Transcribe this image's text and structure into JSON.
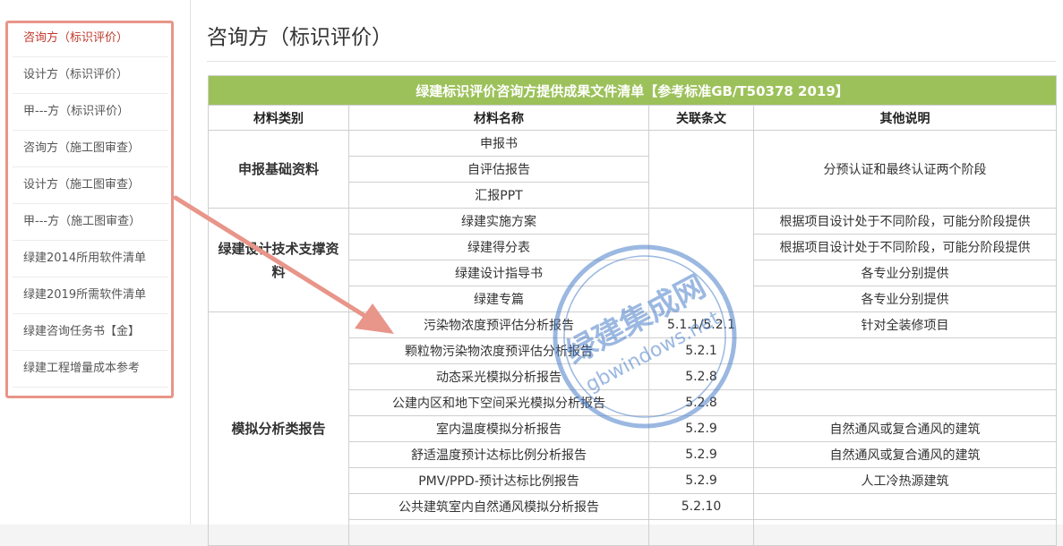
{
  "sidebar": {
    "items": [
      {
        "label": "咨询方（标识评价）",
        "active": true
      },
      {
        "label": "设计方（标识评价）",
        "active": false
      },
      {
        "label": "甲---方（标识评价）",
        "active": false
      },
      {
        "label": "咨询方（施工图审查）",
        "active": false
      },
      {
        "label": "设计方（施工图审查）",
        "active": false
      },
      {
        "label": "甲---方（施工图审查）",
        "active": false
      },
      {
        "label": "绿建2014所用软件清单",
        "active": false
      },
      {
        "label": "绿建2019所需软件清单",
        "active": false
      },
      {
        "label": "绿建咨询任务书【金】",
        "active": false
      },
      {
        "label": "绿建工程增量成本参考",
        "active": false
      }
    ]
  },
  "page": {
    "title": "咨询方（标识评价）"
  },
  "table": {
    "caption": "绿建标识评价咨询方提供成果文件清单【参考标准GB/T50378 2019】",
    "headers": [
      "材料类别",
      "材料名称",
      "关联条文",
      "其他说明"
    ],
    "groups": [
      {
        "category": "申报基础资料",
        "rows": [
          {
            "name": "申报书",
            "clause": "",
            "note": ""
          },
          {
            "name": "自评估报告",
            "clause": "",
            "note": ""
          },
          {
            "name": "汇报PPT",
            "clause": "",
            "note": ""
          }
        ],
        "merged_note": "分预认证和最终认证两个阶段"
      },
      {
        "category": "绿建设计技术支撑资料",
        "rows": [
          {
            "name": "绿建实施方案",
            "clause": "",
            "note": "根据项目设计处于不同阶段，可能分阶段提供"
          },
          {
            "name": "绿建得分表",
            "clause": "",
            "note": "根据项目设计处于不同阶段，可能分阶段提供"
          },
          {
            "name": "绿建设计指导书",
            "clause": "",
            "note": "各专业分别提供"
          },
          {
            "name": "绿建专篇",
            "clause": "",
            "note": "各专业分别提供"
          }
        ]
      },
      {
        "category": "模拟分析类报告",
        "rows": [
          {
            "name": "污染物浓度预评估分析报告",
            "clause": "5.1.1/5.2.1",
            "note": "针对全装修项目"
          },
          {
            "name": "颗粒物污染物浓度预评估分析报告",
            "clause": "5.2.1",
            "note": ""
          },
          {
            "name": "动态采光模拟分析报告",
            "clause": "5.2.8",
            "note": ""
          },
          {
            "name": "公建内区和地下空间采光模拟分析报告",
            "clause": "5.2.8",
            "note": ""
          },
          {
            "name": "室内温度模拟分析报告",
            "clause": "5.2.9",
            "note": "自然通风或复合通风的建筑"
          },
          {
            "name": "舒适温度预计达标比例分析报告",
            "clause": "5.2.9",
            "note": "自然通风或复合通风的建筑"
          },
          {
            "name": "PMV/PPD-预计达标比例报告",
            "clause": "5.2.9",
            "note": "人工冷热源建筑"
          },
          {
            "name": "公共建筑室内自然通风模拟分析报告",
            "clause": "5.2.10",
            "note": ""
          }
        ]
      }
    ]
  },
  "watermark": {
    "text_cn": "绿建集成网",
    "text_en": "gbwindows.net"
  },
  "colors": {
    "caption_bg": "#9cc15a",
    "active_link": "#c0392b",
    "frame": "#e8958a",
    "watermark": "#4a7fc9"
  }
}
